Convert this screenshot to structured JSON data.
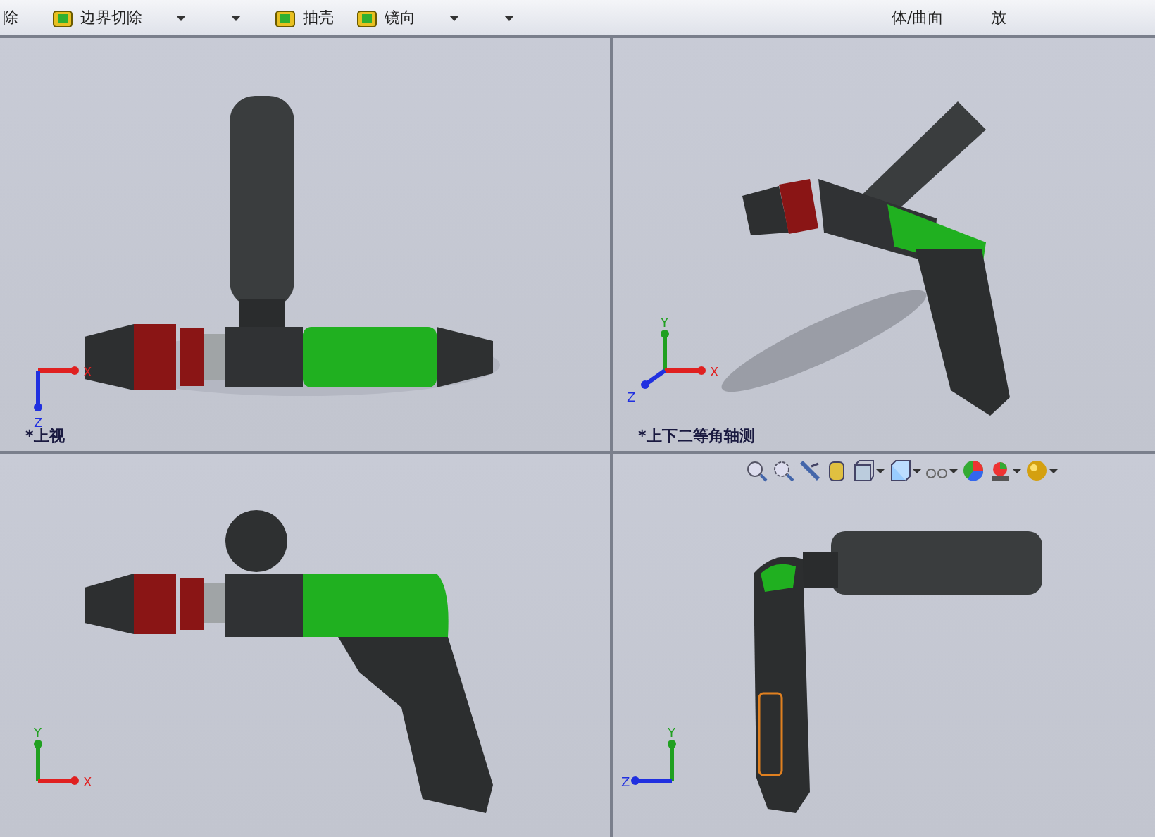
{
  "toolbar": {
    "items": [
      {
        "kind": "text",
        "label": "除"
      },
      {
        "kind": "button",
        "label": "边界切除"
      },
      {
        "kind": "dropdown"
      },
      {
        "kind": "dropdown"
      },
      {
        "kind": "button",
        "label": "抽壳"
      },
      {
        "kind": "button",
        "label": "镜向"
      },
      {
        "kind": "dropdown"
      },
      {
        "kind": "dropdown"
      },
      {
        "kind": "text",
        "label": "体/曲面"
      },
      {
        "kind": "text",
        "label": "放"
      }
    ]
  },
  "viewports": [
    {
      "kind": "top",
      "view_label": "*上视",
      "axes": [
        {
          "label": "X",
          "kind": "right",
          "color": "#e02020"
        },
        {
          "label": "Z",
          "kind": "down",
          "color": "#2030e0"
        }
      ]
    },
    {
      "kind": "iso",
      "view_label": "*上下二等角轴测",
      "axes": [
        {
          "label": "Y",
          "kind": "up",
          "color": "#20a020"
        },
        {
          "label": "X",
          "kind": "right",
          "color": "#e02020"
        },
        {
          "label": "Z",
          "kind": "downleft",
          "color": "#2030e0"
        }
      ]
    },
    {
      "kind": "side",
      "axes": [
        {
          "label": "Y",
          "kind": "up",
          "color": "#20a020"
        },
        {
          "label": "X",
          "kind": "right",
          "color": "#e02020"
        }
      ]
    },
    {
      "kind": "front",
      "axes": [
        {
          "label": "Y",
          "kind": "up",
          "color": "#20a020"
        },
        {
          "label": "Z",
          "kind": "left",
          "color": "#2030e0"
        }
      ]
    }
  ]
}
